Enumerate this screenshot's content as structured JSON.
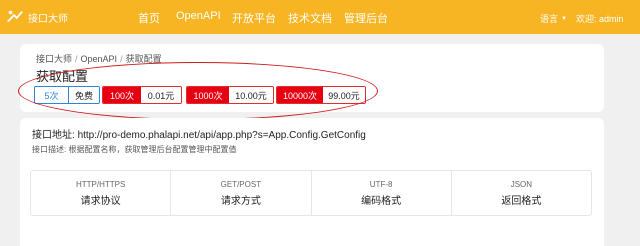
{
  "header": {
    "logo_text": "接口大师",
    "nav": [
      {
        "label": "首页"
      },
      {
        "label": "OpenAPI"
      },
      {
        "label": "开放平台"
      },
      {
        "label": "技术文档"
      },
      {
        "label": "管理后台"
      }
    ],
    "language_label": "语言",
    "user_label": "欢迎: admin",
    "bg_color": "#f7b524"
  },
  "breadcrumb": [
    "接口大师",
    "OpenAPI",
    "获取配置"
  ],
  "page_title": "获取配置",
  "pricing": [
    {
      "count": "5次",
      "price": "免费"
    },
    {
      "count": "100次",
      "price": "0.01元"
    },
    {
      "count": "1000次",
      "price": "10.00元"
    },
    {
      "count": "10000次",
      "price": "99.00元"
    }
  ],
  "api": {
    "address_label": "接口地址:",
    "address_url": "http://pro-demo.phalapi.net/api/app.php?s=App.Config.GetConfig",
    "desc_label": "接口描述:",
    "desc_text": "根据配置名称，获取管理后台配置管理中配置值"
  },
  "info": [
    {
      "top": "HTTP/HTTPS",
      "bottom": "请求协议"
    },
    {
      "top": "GET/POST",
      "bottom": "请求方式"
    },
    {
      "top": "UTF-8",
      "bottom": "编码格式"
    },
    {
      "top": "JSON",
      "bottom": "返回格式"
    }
  ],
  "colors": {
    "accent_red": "#e60012",
    "free_blue": "#2f86d6",
    "annotation": "#d01c1c"
  }
}
